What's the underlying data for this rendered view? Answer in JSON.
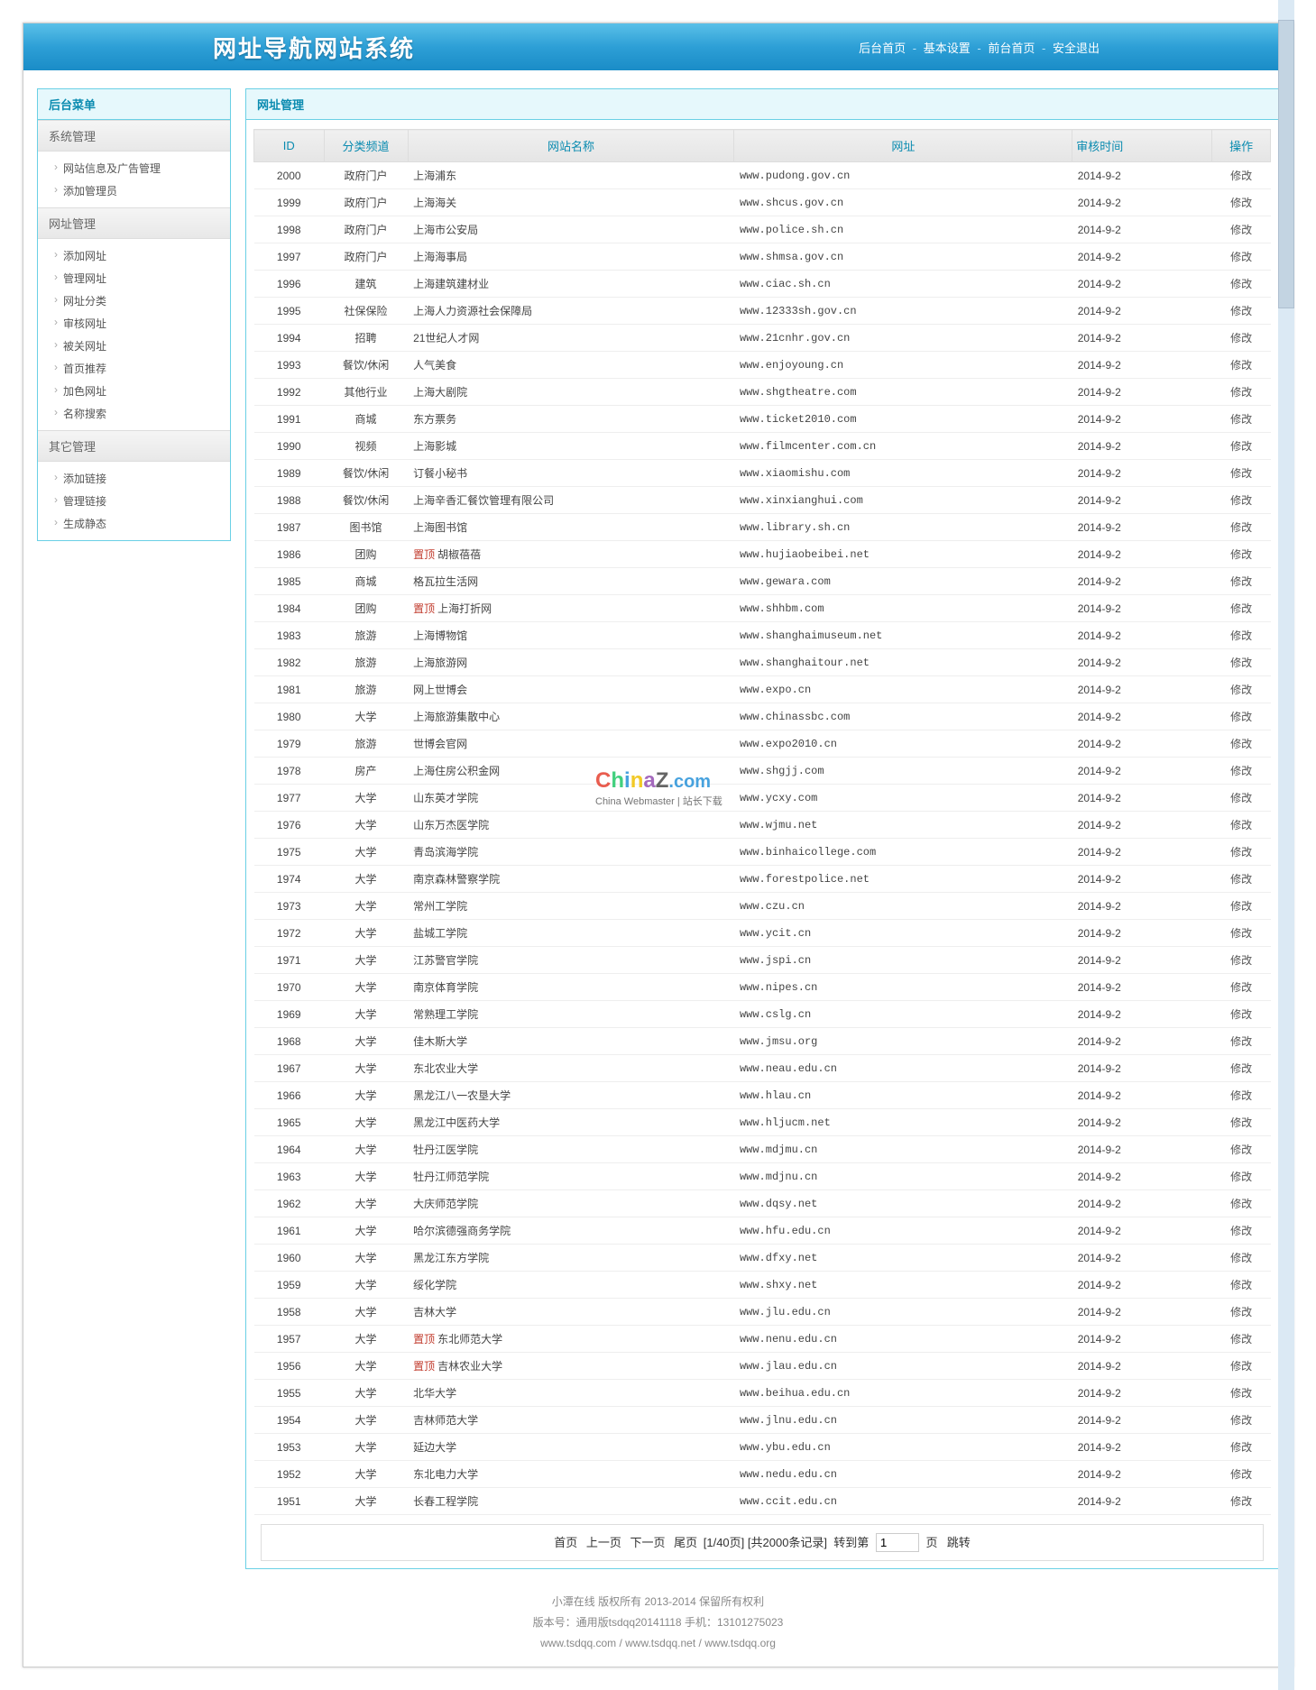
{
  "header": {
    "title": "网址导航网站系统",
    "nav": {
      "home": "后台首页",
      "settings": "基本设置",
      "front": "前台首页",
      "logout": "安全退出"
    }
  },
  "side": {
    "title": "后台菜单",
    "g1": {
      "h": "系统管理",
      "items": [
        "网站信息及广告管理",
        "添加管理员"
      ]
    },
    "g2": {
      "h": "网址管理",
      "items": [
        "添加网址",
        "管理网址",
        "网址分类",
        "审核网址",
        "被关网址",
        "首页推荐",
        "加色网址",
        "名称搜索"
      ]
    },
    "g3": {
      "h": "其它管理",
      "items": [
        "添加链接",
        "管理链接",
        "生成静态"
      ]
    }
  },
  "main": {
    "title": "网址管理",
    "th": {
      "id": "ID",
      "cat": "分类频道",
      "name": "网站名称",
      "url": "网址",
      "date": "审核时间",
      "op": "操作"
    },
    "op_label": "修改",
    "top_tag": "置顶",
    "rows": [
      {
        "id": "2000",
        "cat": "政府门户",
        "name": "上海浦东",
        "url": "www.pudong.gov.cn",
        "date": "2014-9-2"
      },
      {
        "id": "1999",
        "cat": "政府门户",
        "name": "上海海关",
        "url": "www.shcus.gov.cn",
        "date": "2014-9-2"
      },
      {
        "id": "1998",
        "cat": "政府门户",
        "name": "上海市公安局",
        "url": "www.police.sh.cn",
        "date": "2014-9-2"
      },
      {
        "id": "1997",
        "cat": "政府门户",
        "name": "上海海事局",
        "url": "www.shmsa.gov.cn",
        "date": "2014-9-2"
      },
      {
        "id": "1996",
        "cat": "建筑",
        "name": "上海建筑建材业",
        "url": "www.ciac.sh.cn",
        "date": "2014-9-2"
      },
      {
        "id": "1995",
        "cat": "社保保险",
        "name": "上海人力资源社会保障局",
        "url": "www.12333sh.gov.cn",
        "date": "2014-9-2"
      },
      {
        "id": "1994",
        "cat": "招聘",
        "name": "21世纪人才网",
        "url": "www.21cnhr.gov.cn",
        "date": "2014-9-2"
      },
      {
        "id": "1993",
        "cat": "餐饮/休闲",
        "name": "人气美食",
        "url": "www.enjoyoung.cn",
        "date": "2014-9-2"
      },
      {
        "id": "1992",
        "cat": "其他行业",
        "name": "上海大剧院",
        "url": "www.shgtheatre.com",
        "date": "2014-9-2"
      },
      {
        "id": "1991",
        "cat": "商城",
        "name": "东方票务",
        "url": "www.ticket2010.com",
        "date": "2014-9-2"
      },
      {
        "id": "1990",
        "cat": "视频",
        "name": "上海影城",
        "url": "www.filmcenter.com.cn",
        "date": "2014-9-2"
      },
      {
        "id": "1989",
        "cat": "餐饮/休闲",
        "name": "订餐小秘书",
        "url": "www.xiaomishu.com",
        "date": "2014-9-2"
      },
      {
        "id": "1988",
        "cat": "餐饮/休闲",
        "name": "上海辛香汇餐饮管理有限公司",
        "url": "www.xinxianghui.com",
        "date": "2014-9-2"
      },
      {
        "id": "1987",
        "cat": "图书馆",
        "name": "上海图书馆",
        "url": "www.library.sh.cn",
        "date": "2014-9-2"
      },
      {
        "id": "1986",
        "cat": "团购",
        "name": "胡椒蓓蓓",
        "url": "www.hujiaobeibei.net",
        "date": "2014-9-2",
        "top": true
      },
      {
        "id": "1985",
        "cat": "商城",
        "name": "格瓦拉生活网",
        "url": "www.gewara.com",
        "date": "2014-9-2"
      },
      {
        "id": "1984",
        "cat": "团购",
        "name": "上海打折网",
        "url": "www.shhbm.com",
        "date": "2014-9-2",
        "top": true
      },
      {
        "id": "1983",
        "cat": "旅游",
        "name": "上海博物馆",
        "url": "www.shanghaimuseum.net",
        "date": "2014-9-2"
      },
      {
        "id": "1982",
        "cat": "旅游",
        "name": "上海旅游网",
        "url": "www.shanghaitour.net",
        "date": "2014-9-2"
      },
      {
        "id": "1981",
        "cat": "旅游",
        "name": "网上世博会",
        "url": "www.expo.cn",
        "date": "2014-9-2"
      },
      {
        "id": "1980",
        "cat": "大学",
        "name": "上海旅游集散中心",
        "url": "www.chinassbc.com",
        "date": "2014-9-2"
      },
      {
        "id": "1979",
        "cat": "旅游",
        "name": "世博会官网",
        "url": "www.expo2010.cn",
        "date": "2014-9-2"
      },
      {
        "id": "1978",
        "cat": "房产",
        "name": "上海住房公积金网",
        "url": "www.shgjj.com",
        "date": "2014-9-2"
      },
      {
        "id": "1977",
        "cat": "大学",
        "name": "山东英才学院",
        "url": "www.ycxy.com",
        "date": "2014-9-2"
      },
      {
        "id": "1976",
        "cat": "大学",
        "name": "山东万杰医学院",
        "url": "www.wjmu.net",
        "date": "2014-9-2"
      },
      {
        "id": "1975",
        "cat": "大学",
        "name": "青岛滨海学院",
        "url": "www.binhaicollege.com",
        "date": "2014-9-2"
      },
      {
        "id": "1974",
        "cat": "大学",
        "name": "南京森林警察学院",
        "url": "www.forestpolice.net",
        "date": "2014-9-2"
      },
      {
        "id": "1973",
        "cat": "大学",
        "name": "常州工学院",
        "url": "www.czu.cn",
        "date": "2014-9-2"
      },
      {
        "id": "1972",
        "cat": "大学",
        "name": "盐城工学院",
        "url": "www.ycit.cn",
        "date": "2014-9-2"
      },
      {
        "id": "1971",
        "cat": "大学",
        "name": "江苏警官学院",
        "url": "www.jspi.cn",
        "date": "2014-9-2"
      },
      {
        "id": "1970",
        "cat": "大学",
        "name": "南京体育学院",
        "url": "www.nipes.cn",
        "date": "2014-9-2"
      },
      {
        "id": "1969",
        "cat": "大学",
        "name": "常熟理工学院",
        "url": "www.cslg.cn",
        "date": "2014-9-2"
      },
      {
        "id": "1968",
        "cat": "大学",
        "name": "佳木斯大学",
        "url": "www.jmsu.org",
        "date": "2014-9-2"
      },
      {
        "id": "1967",
        "cat": "大学",
        "name": "东北农业大学",
        "url": "www.neau.edu.cn",
        "date": "2014-9-2"
      },
      {
        "id": "1966",
        "cat": "大学",
        "name": "黑龙江八一农垦大学",
        "url": "www.hlau.cn",
        "date": "2014-9-2"
      },
      {
        "id": "1965",
        "cat": "大学",
        "name": "黑龙江中医药大学",
        "url": "www.hljucm.net",
        "date": "2014-9-2"
      },
      {
        "id": "1964",
        "cat": "大学",
        "name": "牡丹江医学院",
        "url": "www.mdjmu.cn",
        "date": "2014-9-2"
      },
      {
        "id": "1963",
        "cat": "大学",
        "name": "牡丹江师范学院",
        "url": "www.mdjnu.cn",
        "date": "2014-9-2"
      },
      {
        "id": "1962",
        "cat": "大学",
        "name": "大庆师范学院",
        "url": "www.dqsy.net",
        "date": "2014-9-2"
      },
      {
        "id": "1961",
        "cat": "大学",
        "name": "哈尔滨德强商务学院",
        "url": "www.hfu.edu.cn",
        "date": "2014-9-2"
      },
      {
        "id": "1960",
        "cat": "大学",
        "name": "黑龙江东方学院",
        "url": "www.dfxy.net",
        "date": "2014-9-2"
      },
      {
        "id": "1959",
        "cat": "大学",
        "name": "绥化学院",
        "url": "www.shxy.net",
        "date": "2014-9-2"
      },
      {
        "id": "1958",
        "cat": "大学",
        "name": "吉林大学",
        "url": "www.jlu.edu.cn",
        "date": "2014-9-2"
      },
      {
        "id": "1957",
        "cat": "大学",
        "name": "东北师范大学",
        "url": "www.nenu.edu.cn",
        "date": "2014-9-2",
        "top": true
      },
      {
        "id": "1956",
        "cat": "大学",
        "name": "吉林农业大学",
        "url": "www.jlau.edu.cn",
        "date": "2014-9-2",
        "top": true
      },
      {
        "id": "1955",
        "cat": "大学",
        "name": "北华大学",
        "url": "www.beihua.edu.cn",
        "date": "2014-9-2"
      },
      {
        "id": "1954",
        "cat": "大学",
        "name": "吉林师范大学",
        "url": "www.jlnu.edu.cn",
        "date": "2014-9-2"
      },
      {
        "id": "1953",
        "cat": "大学",
        "name": "延边大学",
        "url": "www.ybu.edu.cn",
        "date": "2014-9-2"
      },
      {
        "id": "1952",
        "cat": "大学",
        "name": "东北电力大学",
        "url": "www.nedu.edu.cn",
        "date": "2014-9-2"
      },
      {
        "id": "1951",
        "cat": "大学",
        "name": "长春工程学院",
        "url": "www.ccit.edu.cn",
        "date": "2014-9-2"
      }
    ]
  },
  "pager": {
    "first": "首页",
    "prev": "上一页",
    "next": "下一页",
    "last": "尾页",
    "info": "[1/40页] [共2000条记录]",
    "jump_pre": "转到第",
    "jump_suf": "页",
    "go": "跳转",
    "input": "1"
  },
  "footer": {
    "l1": "小潭在线 版权所有 2013-2014 保留所有权利",
    "l2": "版本号：通用版tsdqq20141118 手机：13101275023",
    "l3a": "www.tsdqq.com",
    "l3b": "www.tsdqq.net",
    "l3c": "www.tsdqq.org"
  },
  "wm": {
    "l2": "China Webmaster | 站长下载"
  }
}
